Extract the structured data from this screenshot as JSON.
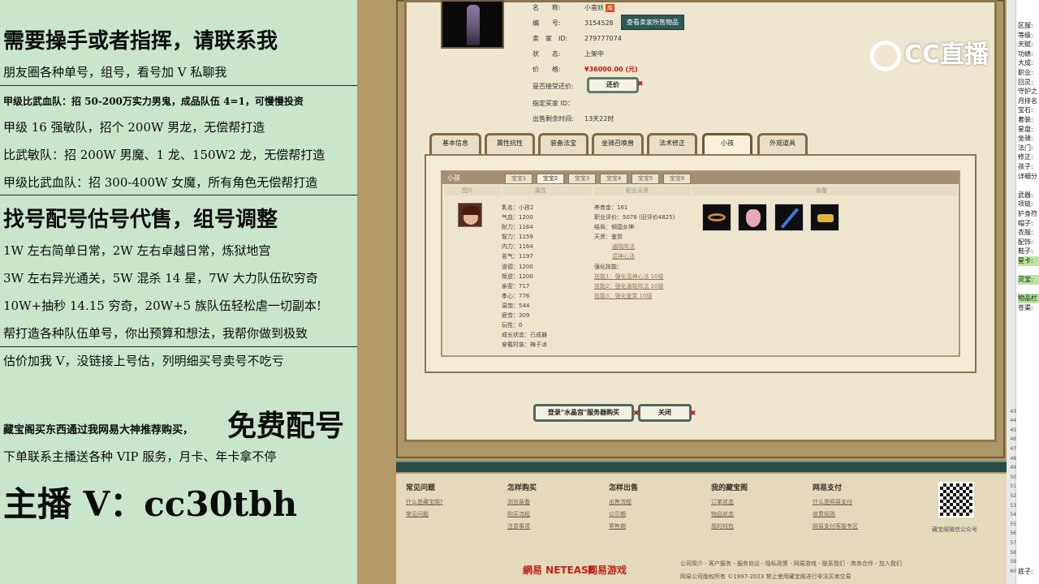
{
  "promo": {
    "line1": "需要操手或者指挥，请联系我",
    "line2": "朋友圈各种单号，组号，看号加 V 私聊我",
    "line3": "甲级比武血队：招 50-200万实力男鬼，成品队伍 4=1，可慢慢投资",
    "line4": "甲级 16 强敏队，招个 200W 男龙，无偿帮打造",
    "line5": "比武敏队：招 200W 男魔、1 龙、150W2 龙，无偿帮打造",
    "line6": "甲级比武血队：招 300-400W 女魔，所有角色无偿帮打造",
    "line7": "找号配号估号代售，组号调整",
    "line8": "1W 左右简单日常，2W 左右卓越日常，炼狱地宫",
    "line9": "3W 左右异光通关，5W 混杀 14 星，7W 大力队伍砍穷奇",
    "line10": "10W+抽秒 14.15 穷奇，20W+5 族队伍轻松虐一切副本!",
    "line11": "帮打造各种队伍单号，你出预算和想法，我帮你做到极致",
    "line12": "估价加我 V，没链接上号估，列明细买号卖号不吃亏",
    "line13a": "藏宝阁买东西通过我网易大神推荐购买，",
    "line13b": "免费配号",
    "line14": "下单联系主播送各种 VIP 服务，月卡、年卡拿不停",
    "line15": "主播 V：cc30tbh"
  },
  "item": {
    "name_label": "名　　称:",
    "name_value": "小蛮妖",
    "name_badge": "库",
    "id_label": "编　　号:",
    "id_value": "3154528",
    "view_seller_btn": "查看卖家所售物品",
    "seller_label": "卖　家　ID:",
    "seller_value": "279777074",
    "status_label": "状　　态:",
    "status_value": "上架中",
    "price_label": "价　　格:",
    "price_value": "¥36000.00 (元)",
    "bargain_label": "是否接受还价:",
    "bargain_btn": "还价",
    "buyer_label": "指定买家 ID：",
    "time_label": "出售剩余时间:",
    "time_value": "13天22时"
  },
  "tabs": [
    "基本信息",
    "属性抗性",
    "装备法宝",
    "坐骑召唤兽",
    "法术修正",
    "小孩",
    "外观道具"
  ],
  "child": {
    "title": "小孩",
    "subtabs": [
      "宝宝1",
      "宝宝2",
      "宝宝3",
      "宝宝4",
      "宝宝5",
      "宝宝6"
    ],
    "col_pic": "图片",
    "col_attr": "属性",
    "col_career": "职业天资",
    "col_equip": "装备",
    "stats": [
      "乳名：小孩2",
      "气血：1200",
      "耐力：1164",
      "智力：1159",
      "内力：1164",
      "名气：1197",
      "道德：1200",
      "叛逆：1200",
      "亲密：717",
      "孝心：776",
      "温饱：544",
      "疲劳：309",
      "玩性：0",
      "成长状态：已成器",
      "穿戴时装：梅子冰"
    ],
    "career": [
      "养育金：161",
      "职业评价：5078 (旧评价4825)",
      "结局：倾国女神",
      "天资：鉴赏",
      "通晓阵法",
      "混神心法",
      "强化技能：",
      "技能1：强化混神心法 10级",
      "技能2：强化通晓阵法 10级",
      "技能3：强化鉴赏 10级"
    ]
  },
  "bottom": {
    "buy_btn": "登录\"水晶宫\"服务器购买",
    "close_btn": "关闭"
  },
  "footer": {
    "col1": "常见问题",
    "col1_links": [
      "什么是藏宝阁?",
      "常见问题"
    ],
    "col2": "怎样购买",
    "col2_links": [
      "浏览装备",
      "购买流程",
      "注意事项"
    ],
    "col3": "怎样出售",
    "col3_links": [
      "出售流程",
      "公示期",
      "寄售期"
    ],
    "col4": "我的藏宝阁",
    "col4_links": [
      "订单状态",
      "物品状态",
      "我的钱包"
    ],
    "col5": "网易支付",
    "col5_links": [
      "什么是网易支付",
      "收费规则",
      "网易支付客服专区"
    ],
    "qr_label": "藏宝阁微信公众号",
    "logo1": "網易 NETEASE",
    "logo2": "网易游戏",
    "links": "公司简介 - 客户服务 - 服务协议 - 隐私政策 - 网易游戏 - 联系我们 - 商务合作 - 加入我们",
    "copyright": "网易公司版权所有 ©1997-2023  禁止使用藏宝阁进行非法买卖交易"
  },
  "cc_logo": "CC直播",
  "sheet_rows": [
    "区服:",
    "等级:",
    "天赋:",
    "功绩:",
    "大成:",
    "职业:",
    "回灵:",
    "守护之",
    "月排名",
    "宝石:",
    "套装:",
    "星盘:",
    "坐骑:",
    "法门:",
    "修正:",
    "孩子:",
    "详细分",
    "",
    "武器:",
    "项链:",
    "护身符",
    "帽子:",
    "衣服:",
    "配饰:",
    "鞋子:",
    "星卡:",
    "",
    "灵宝:",
    "",
    "物品栏",
    "苍渠:",
    "",
    "",
    "",
    "",
    "",
    "",
    "",
    "",
    "",
    "",
    "",
    "",
    "",
    "",
    "",
    "",
    "",
    "",
    "",
    "",
    "",
    "",
    "",
    "",
    "",
    "",
    "",
    "底子:"
  ],
  "colors": {
    "accent": "#2f5954",
    "price": "#c2180e",
    "promo_bg": "#c9e6cd"
  }
}
